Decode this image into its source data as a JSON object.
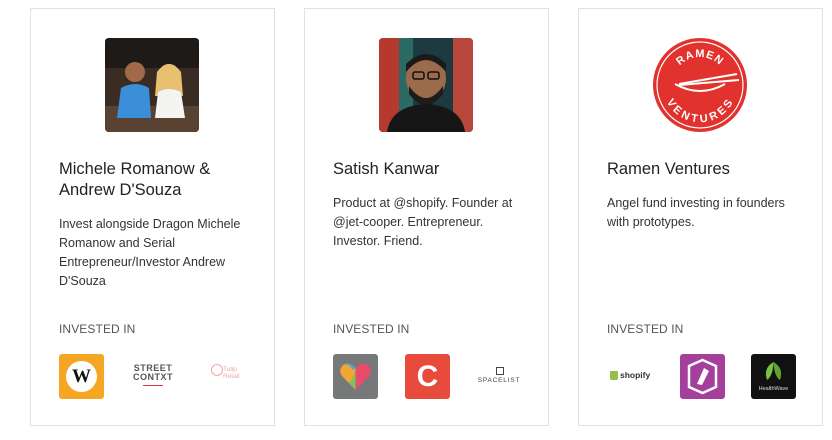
{
  "invested_in_label": "INVESTED IN",
  "investors": [
    {
      "name_line1": "Michele Romanow &",
      "name_line2": "Andrew D'Souza",
      "description": "Invest alongside Dragon Michele Romanow and Serial Entrepreneur/Investor Andrew D'Souza",
      "logos": [
        {
          "icon": "wealthsimple-w",
          "text": "W",
          "color": "#f5a623"
        },
        {
          "icon": "street-contxt",
          "text_line1": "STREET",
          "text_line2": "CONTXT",
          "color": "#555555",
          "accent": "#e03a3a"
        },
        {
          "icon": "tulip-retail",
          "text": "Tulip Retail",
          "color": "#f3a3a8"
        }
      ]
    },
    {
      "name_line1": "Satish Kanwar",
      "name_line2": "",
      "description": "Product at @shopify. Founder at @jet-cooper. Entrepreneur. Investor. Friend.",
      "logos": [
        {
          "icon": "heart-logo",
          "color": "#77787a"
        },
        {
          "icon": "c-logo",
          "text": "C",
          "color": "#e84a3c"
        },
        {
          "icon": "spacelist",
          "text": "SPACELIST",
          "color": "#444444"
        }
      ]
    },
    {
      "name_line1": "Ramen Ventures",
      "name_line2": "",
      "description": "Angel fund investing in founders with prototypes.",
      "avatar_text_top": "RAMEN",
      "avatar_text_bottom": "VENTURES",
      "logos": [
        {
          "icon": "shopify",
          "text": "shopify",
          "color": "#95bf47"
        },
        {
          "icon": "purple-logo",
          "color": "#a43f9b"
        },
        {
          "icon": "healthwave",
          "text": "HealthWave",
          "color": "#111111",
          "accent": "#7ac143"
        }
      ]
    }
  ]
}
